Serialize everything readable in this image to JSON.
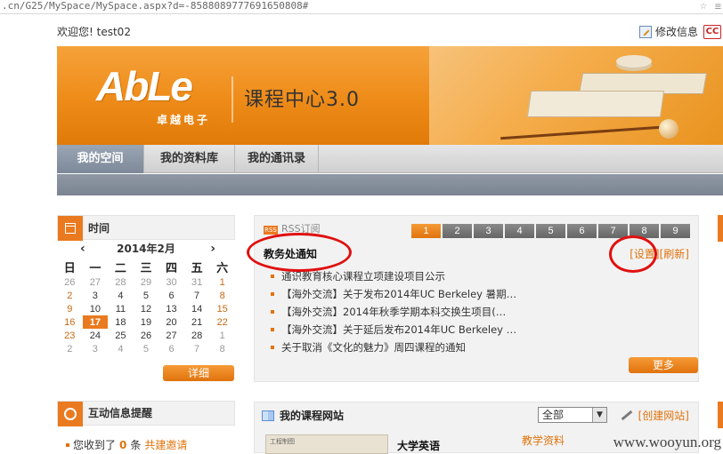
{
  "browser": {
    "url": ".cn/G25/MySpace/MySpace.aspx?d=-858808977769165080​8#"
  },
  "welcome": {
    "greeting": "欢迎您!",
    "username": "test02",
    "edit_label": "修改信息",
    "cc_label": "CC"
  },
  "banner": {
    "logo": "AbLe",
    "logo_sub": "卓越电子",
    "title": "课程中心3.0"
  },
  "nav": {
    "tabs": [
      "我的空间",
      "我的资料库",
      "我的通讯录"
    ],
    "active": 0
  },
  "calendar": {
    "title": "时间",
    "month_label": "2014年2月",
    "prev": "‹",
    "next": "›",
    "weekdays": [
      "日",
      "一",
      "二",
      "三",
      "四",
      "五",
      "六"
    ],
    "weeks": [
      [
        "26",
        "27",
        "28",
        "29",
        "30",
        "31",
        "1"
      ],
      [
        "2",
        "3",
        "4",
        "5",
        "6",
        "7",
        "8"
      ],
      [
        "9",
        "10",
        "11",
        "12",
        "13",
        "14",
        "15"
      ],
      [
        "16",
        "17",
        "18",
        "19",
        "20",
        "21",
        "22"
      ],
      [
        "23",
        "24",
        "25",
        "26",
        "27",
        "28",
        "1"
      ],
      [
        "2",
        "3",
        "4",
        "5",
        "6",
        "7",
        "8"
      ]
    ],
    "today": "17",
    "detail_button": "详细"
  },
  "rss": {
    "label": "RSS订阅",
    "pages": [
      "1",
      "2",
      "3",
      "4",
      "5",
      "6",
      "7",
      "8",
      "9"
    ],
    "active_page": "1",
    "section_title": "教务处通知",
    "settings_link": "[设置]",
    "refresh_link": "[刷新]",
    "items": [
      "通识教育核心课程立项建设项目公示",
      "【海外交流】关于发布2014年UC Berkeley 暑期…",
      "【海外交流】2014年秋季学期本科交换生项目(…",
      "【海外交流】关于延后发布2014年UC Berkeley …",
      "关于取消《文化的魅力》周四课程的通知"
    ],
    "more_button": "更多"
  },
  "reminder": {
    "title": "互动信息提醒",
    "prefix": "您收到了",
    "count": "0",
    "unit": "条",
    "link": "共建邀请"
  },
  "courses": {
    "title": "我的课程网站",
    "filter": "全部",
    "create_link": "[创建网站]",
    "course_name": "大学英语",
    "materials_link": "教学资料",
    "thumb_text": "工程制图"
  },
  "watermark": "www.wooyun.org",
  "colors": {
    "accent": "#ea7a1f",
    "annotation": "#e01010",
    "nav_active": "#7d8999"
  }
}
